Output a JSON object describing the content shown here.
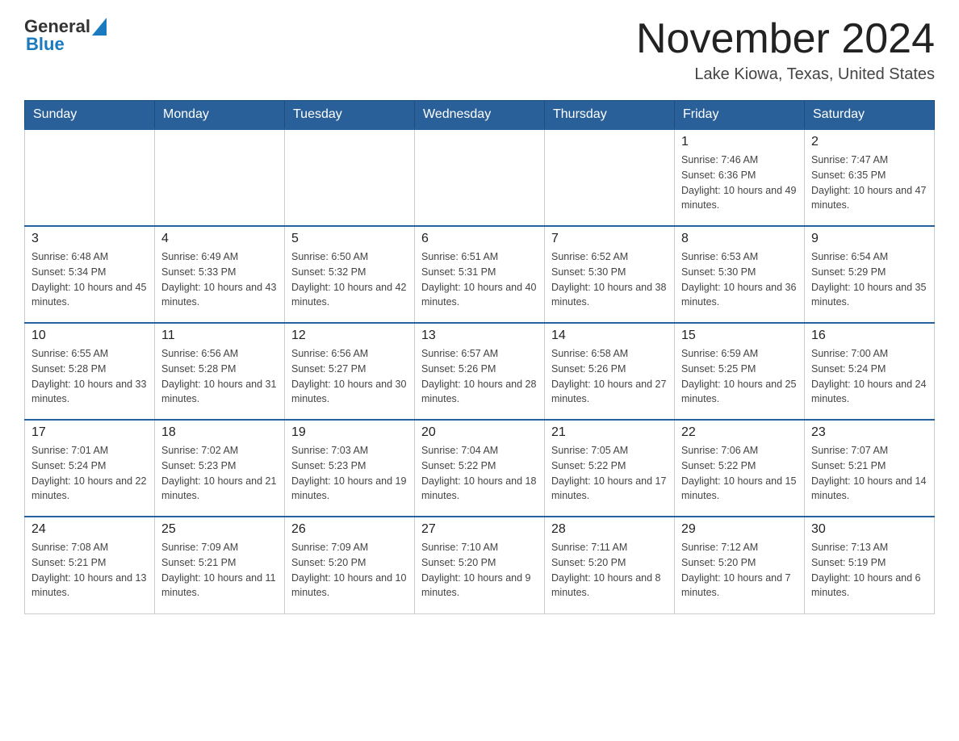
{
  "header": {
    "logo_general": "General",
    "logo_blue": "Blue",
    "month_title": "November 2024",
    "location": "Lake Kiowa, Texas, United States"
  },
  "days_of_week": [
    "Sunday",
    "Monday",
    "Tuesday",
    "Wednesday",
    "Thursday",
    "Friday",
    "Saturday"
  ],
  "weeks": [
    [
      {
        "day": "",
        "sunrise": "",
        "sunset": "",
        "daylight": ""
      },
      {
        "day": "",
        "sunrise": "",
        "sunset": "",
        "daylight": ""
      },
      {
        "day": "",
        "sunrise": "",
        "sunset": "",
        "daylight": ""
      },
      {
        "day": "",
        "sunrise": "",
        "sunset": "",
        "daylight": ""
      },
      {
        "day": "",
        "sunrise": "",
        "sunset": "",
        "daylight": ""
      },
      {
        "day": "1",
        "sunrise": "Sunrise: 7:46 AM",
        "sunset": "Sunset: 6:36 PM",
        "daylight": "Daylight: 10 hours and 49 minutes."
      },
      {
        "day": "2",
        "sunrise": "Sunrise: 7:47 AM",
        "sunset": "Sunset: 6:35 PM",
        "daylight": "Daylight: 10 hours and 47 minutes."
      }
    ],
    [
      {
        "day": "3",
        "sunrise": "Sunrise: 6:48 AM",
        "sunset": "Sunset: 5:34 PM",
        "daylight": "Daylight: 10 hours and 45 minutes."
      },
      {
        "day": "4",
        "sunrise": "Sunrise: 6:49 AM",
        "sunset": "Sunset: 5:33 PM",
        "daylight": "Daylight: 10 hours and 43 minutes."
      },
      {
        "day": "5",
        "sunrise": "Sunrise: 6:50 AM",
        "sunset": "Sunset: 5:32 PM",
        "daylight": "Daylight: 10 hours and 42 minutes."
      },
      {
        "day": "6",
        "sunrise": "Sunrise: 6:51 AM",
        "sunset": "Sunset: 5:31 PM",
        "daylight": "Daylight: 10 hours and 40 minutes."
      },
      {
        "day": "7",
        "sunrise": "Sunrise: 6:52 AM",
        "sunset": "Sunset: 5:30 PM",
        "daylight": "Daylight: 10 hours and 38 minutes."
      },
      {
        "day": "8",
        "sunrise": "Sunrise: 6:53 AM",
        "sunset": "Sunset: 5:30 PM",
        "daylight": "Daylight: 10 hours and 36 minutes."
      },
      {
        "day": "9",
        "sunrise": "Sunrise: 6:54 AM",
        "sunset": "Sunset: 5:29 PM",
        "daylight": "Daylight: 10 hours and 35 minutes."
      }
    ],
    [
      {
        "day": "10",
        "sunrise": "Sunrise: 6:55 AM",
        "sunset": "Sunset: 5:28 PM",
        "daylight": "Daylight: 10 hours and 33 minutes."
      },
      {
        "day": "11",
        "sunrise": "Sunrise: 6:56 AM",
        "sunset": "Sunset: 5:28 PM",
        "daylight": "Daylight: 10 hours and 31 minutes."
      },
      {
        "day": "12",
        "sunrise": "Sunrise: 6:56 AM",
        "sunset": "Sunset: 5:27 PM",
        "daylight": "Daylight: 10 hours and 30 minutes."
      },
      {
        "day": "13",
        "sunrise": "Sunrise: 6:57 AM",
        "sunset": "Sunset: 5:26 PM",
        "daylight": "Daylight: 10 hours and 28 minutes."
      },
      {
        "day": "14",
        "sunrise": "Sunrise: 6:58 AM",
        "sunset": "Sunset: 5:26 PM",
        "daylight": "Daylight: 10 hours and 27 minutes."
      },
      {
        "day": "15",
        "sunrise": "Sunrise: 6:59 AM",
        "sunset": "Sunset: 5:25 PM",
        "daylight": "Daylight: 10 hours and 25 minutes."
      },
      {
        "day": "16",
        "sunrise": "Sunrise: 7:00 AM",
        "sunset": "Sunset: 5:24 PM",
        "daylight": "Daylight: 10 hours and 24 minutes."
      }
    ],
    [
      {
        "day": "17",
        "sunrise": "Sunrise: 7:01 AM",
        "sunset": "Sunset: 5:24 PM",
        "daylight": "Daylight: 10 hours and 22 minutes."
      },
      {
        "day": "18",
        "sunrise": "Sunrise: 7:02 AM",
        "sunset": "Sunset: 5:23 PM",
        "daylight": "Daylight: 10 hours and 21 minutes."
      },
      {
        "day": "19",
        "sunrise": "Sunrise: 7:03 AM",
        "sunset": "Sunset: 5:23 PM",
        "daylight": "Daylight: 10 hours and 19 minutes."
      },
      {
        "day": "20",
        "sunrise": "Sunrise: 7:04 AM",
        "sunset": "Sunset: 5:22 PM",
        "daylight": "Daylight: 10 hours and 18 minutes."
      },
      {
        "day": "21",
        "sunrise": "Sunrise: 7:05 AM",
        "sunset": "Sunset: 5:22 PM",
        "daylight": "Daylight: 10 hours and 17 minutes."
      },
      {
        "day": "22",
        "sunrise": "Sunrise: 7:06 AM",
        "sunset": "Sunset: 5:22 PM",
        "daylight": "Daylight: 10 hours and 15 minutes."
      },
      {
        "day": "23",
        "sunrise": "Sunrise: 7:07 AM",
        "sunset": "Sunset: 5:21 PM",
        "daylight": "Daylight: 10 hours and 14 minutes."
      }
    ],
    [
      {
        "day": "24",
        "sunrise": "Sunrise: 7:08 AM",
        "sunset": "Sunset: 5:21 PM",
        "daylight": "Daylight: 10 hours and 13 minutes."
      },
      {
        "day": "25",
        "sunrise": "Sunrise: 7:09 AM",
        "sunset": "Sunset: 5:21 PM",
        "daylight": "Daylight: 10 hours and 11 minutes."
      },
      {
        "day": "26",
        "sunrise": "Sunrise: 7:09 AM",
        "sunset": "Sunset: 5:20 PM",
        "daylight": "Daylight: 10 hours and 10 minutes."
      },
      {
        "day": "27",
        "sunrise": "Sunrise: 7:10 AM",
        "sunset": "Sunset: 5:20 PM",
        "daylight": "Daylight: 10 hours and 9 minutes."
      },
      {
        "day": "28",
        "sunrise": "Sunrise: 7:11 AM",
        "sunset": "Sunset: 5:20 PM",
        "daylight": "Daylight: 10 hours and 8 minutes."
      },
      {
        "day": "29",
        "sunrise": "Sunrise: 7:12 AM",
        "sunset": "Sunset: 5:20 PM",
        "daylight": "Daylight: 10 hours and 7 minutes."
      },
      {
        "day": "30",
        "sunrise": "Sunrise: 7:13 AM",
        "sunset": "Sunset: 5:19 PM",
        "daylight": "Daylight: 10 hours and 6 minutes."
      }
    ]
  ]
}
